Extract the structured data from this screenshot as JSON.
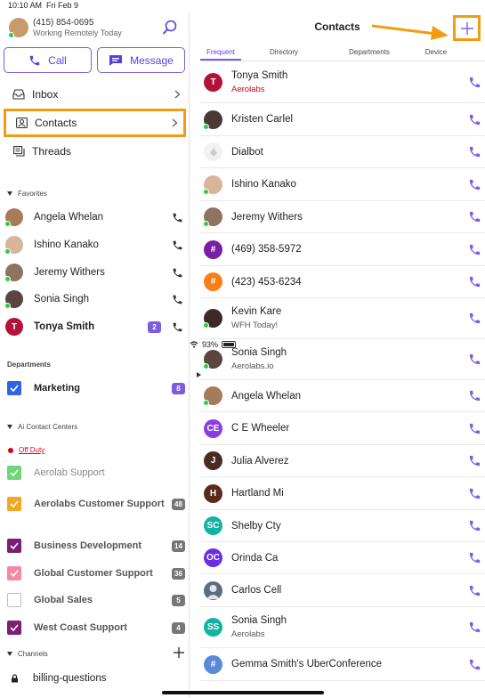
{
  "status": {
    "time": "10:10 AM",
    "date": "Fri Feb 9",
    "battery": "93%"
  },
  "user": {
    "phone": "(415) 854-0695",
    "status": "Working Remotely Today"
  },
  "actions": {
    "call": "Call",
    "message": "Message"
  },
  "nav": [
    {
      "label": "Inbox",
      "icon": "inbox-icon"
    },
    {
      "label": "Contacts",
      "icon": "contacts-icon"
    },
    {
      "label": "Threads",
      "icon": "threads-icon"
    }
  ],
  "favorites": {
    "title": "Favorites",
    "items": [
      {
        "name": "Angela Whelan"
      },
      {
        "name": "Ishino Kanako"
      },
      {
        "name": "Jeremy Withers"
      },
      {
        "name": "Sonia  Singh"
      },
      {
        "name": "Tonya Smith",
        "initial": "T",
        "badge": "2"
      }
    ]
  },
  "departments": {
    "title": "Departments",
    "items": [
      {
        "name": "Marketing",
        "badge": "8"
      }
    ]
  },
  "contact_centers": {
    "title": "Ai Contact Centers",
    "status": "Off Duty",
    "items": [
      {
        "name": "Aerolab Support"
      },
      {
        "name": "Aerolabs Customer Support",
        "badge": "48"
      },
      {
        "name": "Business Development",
        "badge": "14"
      },
      {
        "name": "Global Customer Support",
        "badge": "36"
      },
      {
        "name": "Global Sales",
        "badge": "5"
      },
      {
        "name": "West Coast Support",
        "badge": "4"
      }
    ]
  },
  "channels": {
    "title": "Channels",
    "items": [
      {
        "name": "billing-questions"
      }
    ]
  },
  "contacts": {
    "title": "Contacts",
    "tabs": [
      "Frequent",
      "Directory",
      "Departments",
      "Device"
    ],
    "active_tab": "Frequent",
    "list": [
      {
        "name": "Tonya Smith",
        "sub": "Aerolabs",
        "initial": "T"
      },
      {
        "name": "Kristen Carlel"
      },
      {
        "name": "Dialbot"
      },
      {
        "name": "Ishino Kanako"
      },
      {
        "name": "Jeremy Withers"
      },
      {
        "name": "(469) 358-5972",
        "initial": "#"
      },
      {
        "name": "(423) 453-6234",
        "initial": "#"
      },
      {
        "name": "Kevin Kare",
        "sub": "WFH Today!"
      },
      {
        "name": "Sonia  Singh",
        "sub": "Aerolabs.io"
      },
      {
        "name": "Angela Whelan"
      },
      {
        "name": "C E Wheeler",
        "initial": "CE"
      },
      {
        "name": "Julia Alverez",
        "initial": "J"
      },
      {
        "name": "Hartland Mi",
        "initial": "H"
      },
      {
        "name": "Shelby Cty",
        "initial": "SC"
      },
      {
        "name": "Orinda Ca",
        "initial": "OC"
      },
      {
        "name": "Carlos Cell"
      },
      {
        "name": "Sonia Singh",
        "sub": "Aerolabs",
        "initial": "SS"
      },
      {
        "name": "Gemma Smith's UberConference",
        "initial": "#"
      }
    ]
  },
  "colors": {
    "accent": "#7c5ce0",
    "highlight": "#f39c12",
    "online": "#2ecc40",
    "alert": "#d0021b"
  }
}
